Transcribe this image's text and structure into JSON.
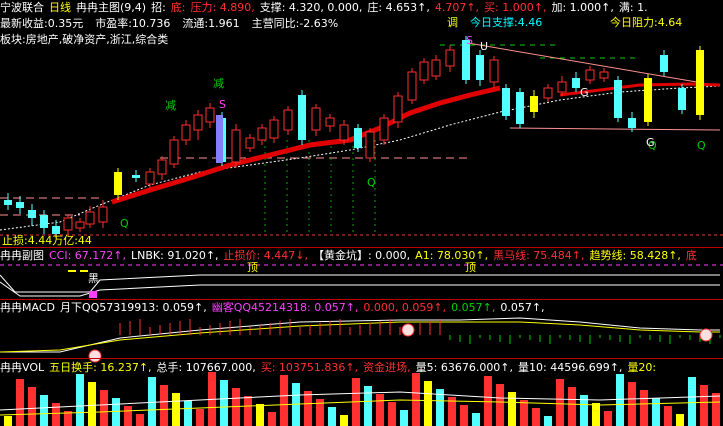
{
  "colors": {
    "up": "#ff3030",
    "down": "#54ffff",
    "yellow": "#ffff00",
    "white": "#ffffff",
    "magenta": "#ff40ff",
    "green": "#00d000",
    "grid": "#c00000",
    "bg": "#000000"
  },
  "header": {
    "row1": [
      {
        "t": "宁波联合",
        "c": "#ffffff"
      },
      {
        "t": "日线",
        "c": "#ffff00"
      },
      {
        "t": "冉冉主图(9,4)",
        "c": "#ffffff"
      },
      {
        "t": "招:",
        "c": "#ffffff"
      },
      {
        "t": "底:",
        "c": "#ff3030"
      },
      {
        "t": "压力: 4.890,",
        "c": "#ff3030"
      },
      {
        "t": "支撑: 4.320, 0.000,",
        "c": "#ffffff"
      },
      {
        "t": "庄: 4.653↑,",
        "c": "#ffffff"
      },
      {
        "t": "4.707↑,",
        "c": "#ff3030"
      },
      {
        "t": "买: 1.000↑,",
        "c": "#ff3030"
      },
      {
        "t": "加: 1.000↑,",
        "c": "#ffffff"
      },
      {
        "t": "满: 1.",
        "c": "#ffffff"
      }
    ],
    "row2": [
      {
        "t": "最新收益:0.35元",
        "c": "#ffffff"
      },
      {
        "t": "市盈率:10.736",
        "c": "#ffffff"
      },
      {
        "t": "流通:1.961",
        "c": "#ffffff"
      },
      {
        "t": "主营同比:-2.63%",
        "c": "#ffffff"
      }
    ],
    "row3": "板块:房地产,破净资产,浙江,综合类",
    "support_tag": "调",
    "today_support": "今日支撑:4.46",
    "today_resist": "今日阻力:4.64"
  },
  "main_labels": {
    "jian1": "减",
    "jian2": "减",
    "s1": "S",
    "s2": "S",
    "q1": "Q",
    "q2": "Q",
    "q3": "Q",
    "q4": "Q",
    "g1": "G",
    "g2": "G",
    "u": "U",
    "stop_loss": "止损:4.44万亿:44"
  },
  "sub1": {
    "items": [
      {
        "t": "冉冉副图",
        "c": "#ffffff"
      },
      {
        "t": "CCI: 67.172↑,",
        "c": "#ff40ff"
      },
      {
        "t": "LNBK: 91.020↑,",
        "c": "#ffffff"
      },
      {
        "t": "止损价: 4.447↓,",
        "c": "#ff3030"
      },
      {
        "t": "【黄金坑】: 0.000,",
        "c": "#ffffff"
      },
      {
        "t": "A1: 78.030↑,",
        "c": "#ffff00"
      },
      {
        "t": "黑马线: 75.484↑,",
        "c": "#ff3030"
      },
      {
        "t": "趋势线: 58.428↑,",
        "c": "#ffff00"
      },
      {
        "t": "底",
        "c": "#ff3030"
      }
    ],
    "hei": "黑",
    "ding1": "顶",
    "ding2": "顶"
  },
  "macd": {
    "items": [
      {
        "t": "冉冉MACD",
        "c": "#ffffff"
      },
      {
        "t": "月下QQ57319913: 0.059↑,",
        "c": "#ffffff"
      },
      {
        "t": "幽客QQ45214318: 0.057↑,",
        "c": "#ff40ff"
      },
      {
        "t": "0.000, 0.059↑,",
        "c": "#ff3030"
      },
      {
        "t": "0.057↑,",
        "c": "#00d000"
      },
      {
        "t": "0.057↑,",
        "c": "#ffffff"
      }
    ]
  },
  "vol": {
    "items": [
      {
        "t": "冉冉VOL",
        "c": "#ffffff"
      },
      {
        "t": "五日换手: 16.237↑,",
        "c": "#ffff00"
      },
      {
        "t": "总手: 107667.000,",
        "c": "#ffffff"
      },
      {
        "t": "买: 103751.836↑,",
        "c": "#ff3030"
      },
      {
        "t": "资金进场,",
        "c": "#ff3030"
      },
      {
        "t": "量5: 63676.000↑,",
        "c": "#ffffff"
      },
      {
        "t": "量10: 44596.699↑,",
        "c": "#ffffff"
      },
      {
        "t": "量20:",
        "c": "#ffff00"
      }
    ]
  }
}
